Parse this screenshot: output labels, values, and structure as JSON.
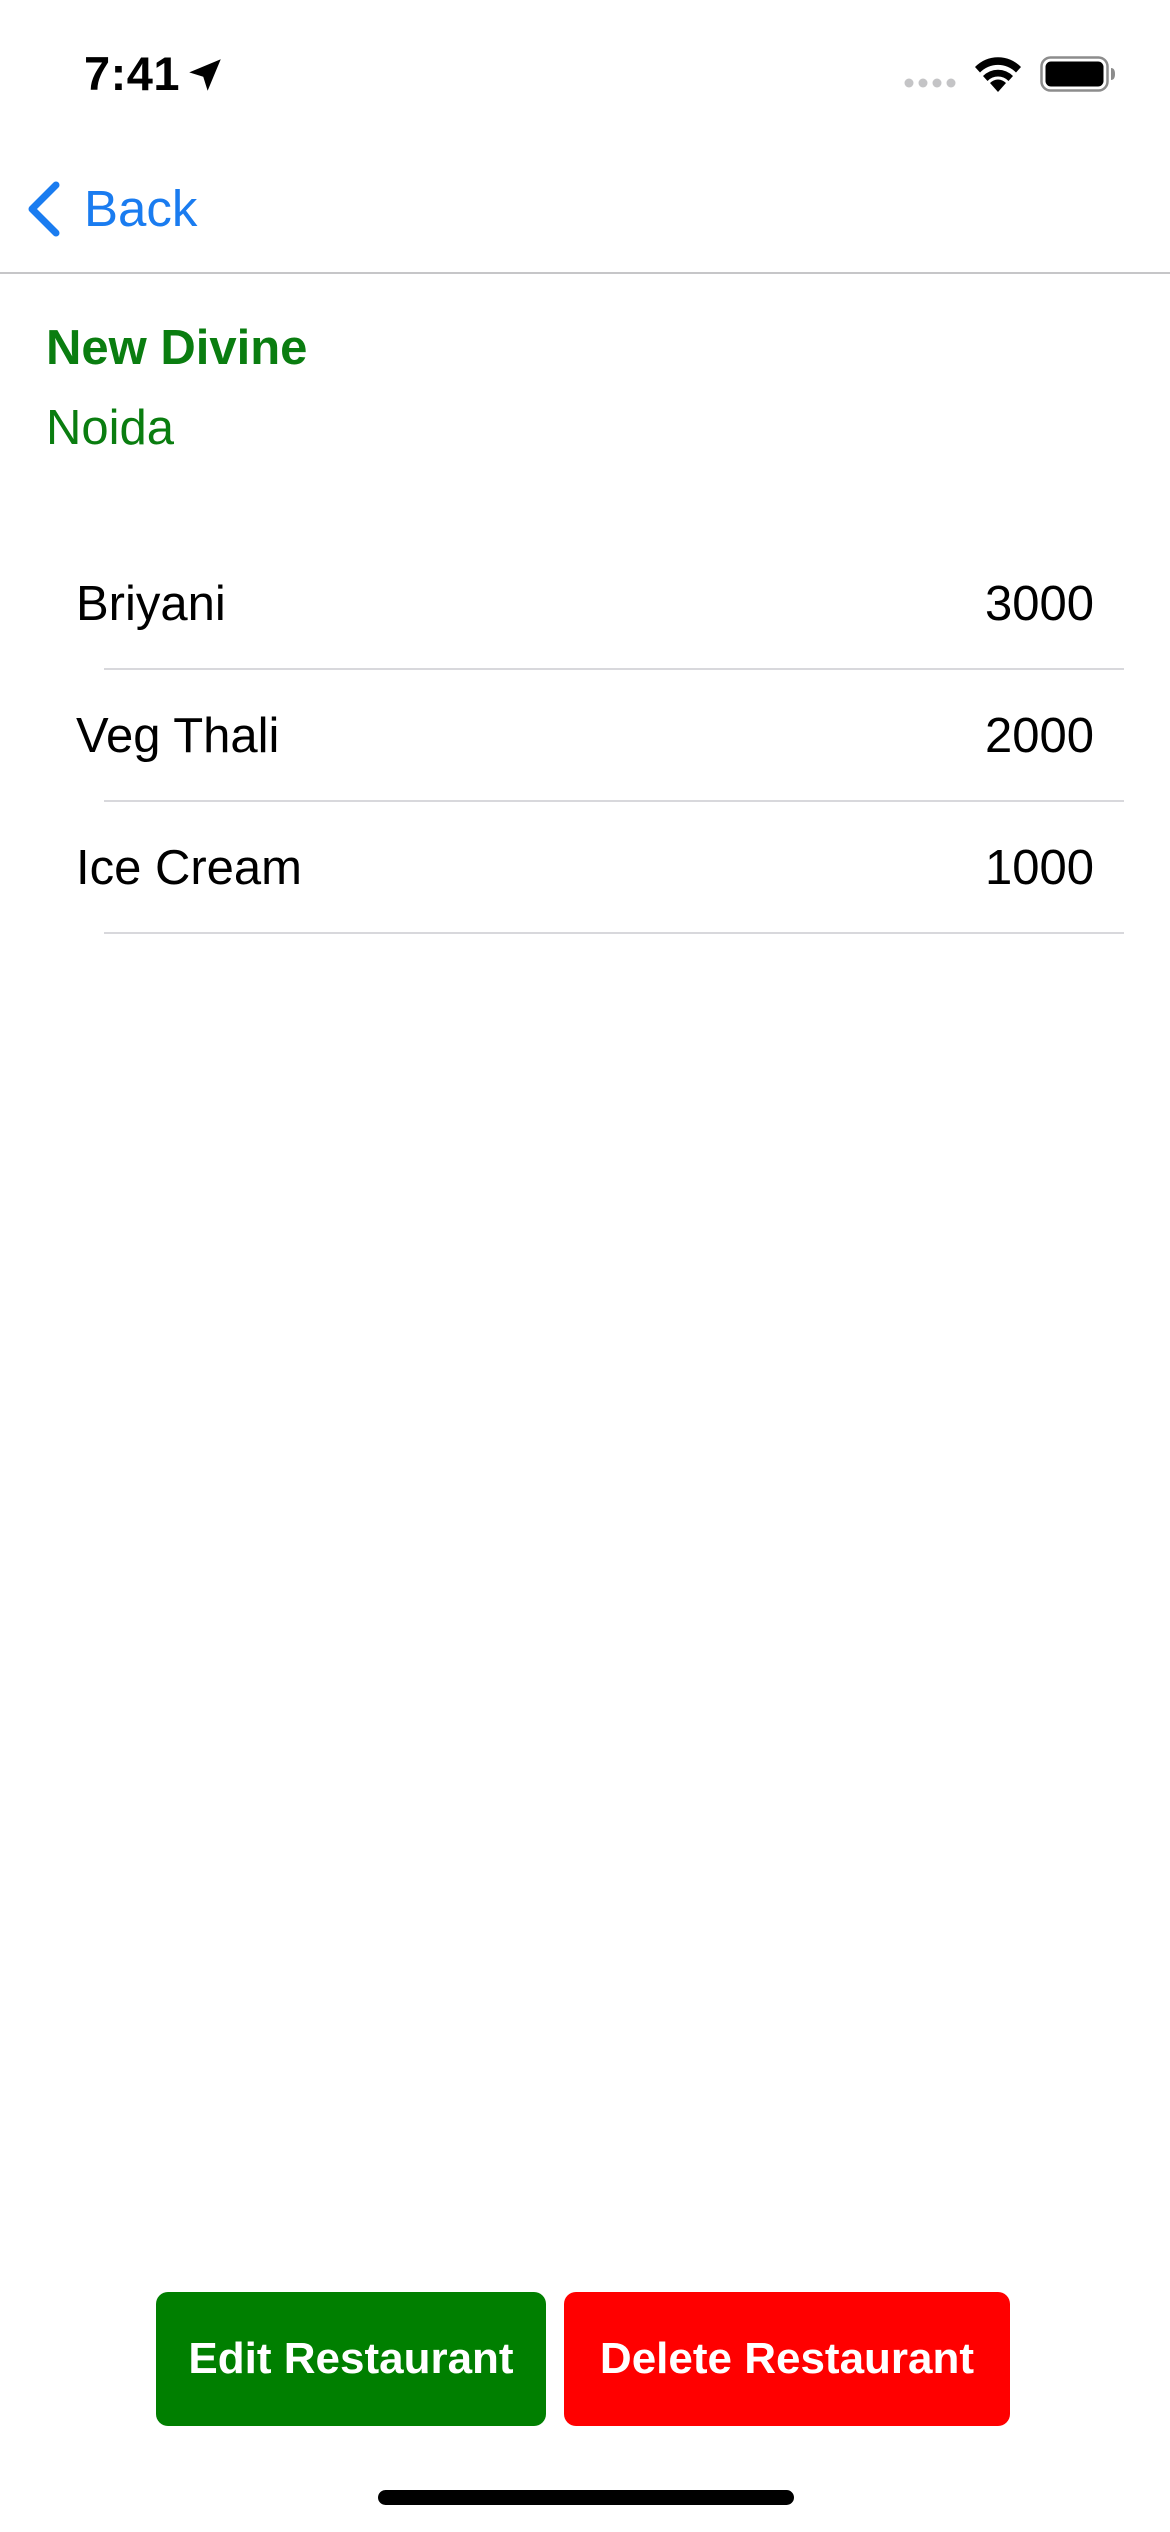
{
  "status_bar": {
    "time": "7:41",
    "icons": {
      "location": "location-arrow-icon",
      "signal": "cellular-signal-icon",
      "wifi": "wifi-icon",
      "battery": "battery-full-icon"
    }
  },
  "nav_bar": {
    "back_label": "Back",
    "back_icon": "chevron-left-icon"
  },
  "restaurant": {
    "name": "New Divine",
    "location": "Noida"
  },
  "menu": {
    "items": [
      {
        "name": "Briyani",
        "price": "3000"
      },
      {
        "name": "Veg Thali",
        "price": "2000"
      },
      {
        "name": "Ice Cream",
        "price": "1000"
      }
    ]
  },
  "actions": {
    "edit_label": "Edit Restaurant",
    "delete_label": "Delete Restaurant"
  },
  "colors": {
    "accent_blue": "#1a7cf0",
    "brand_green": "#0a7d10",
    "edit_button": "#007f00",
    "delete_button": "#ff0000",
    "separator": "#d8d8dc"
  }
}
